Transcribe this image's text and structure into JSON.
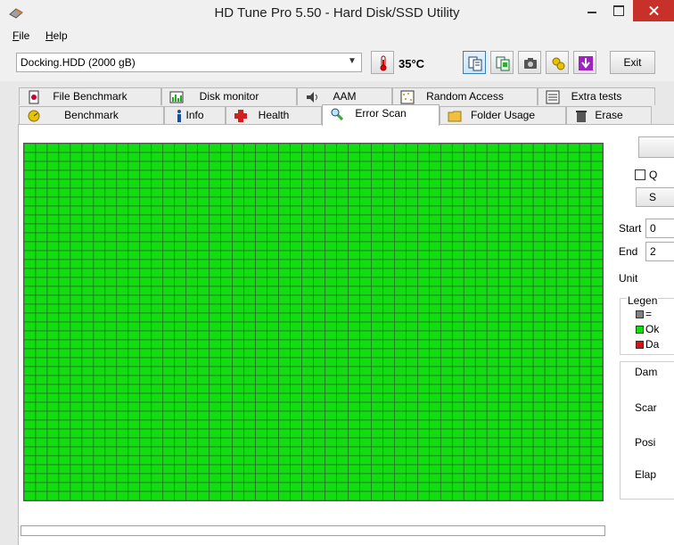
{
  "window": {
    "title": "HD Tune Pro 5.50 - Hard Disk/SSD Utility"
  },
  "menu": {
    "file_key": "F",
    "file_rest": "ile",
    "help_key": "H",
    "help_rest": "elp"
  },
  "toolbar": {
    "drive": "Docking.HDD (2000 gB)",
    "temperature": "35°C",
    "exit_label": "Exit"
  },
  "tabs_top": [
    {
      "label": "File Benchmark",
      "icon": "file-benchmark-icon"
    },
    {
      "label": "Disk monitor",
      "icon": "disk-monitor-icon"
    },
    {
      "label": "AAM",
      "icon": "speaker-icon"
    },
    {
      "label": "Random Access",
      "icon": "random-access-icon"
    },
    {
      "label": "Extra tests",
      "icon": "extra-tests-icon"
    }
  ],
  "tabs_bottom": [
    {
      "label": "Benchmark",
      "icon": "benchmark-icon"
    },
    {
      "label": "Info",
      "icon": "info-icon"
    },
    {
      "label": "Health",
      "icon": "health-cross-icon"
    },
    {
      "label": "Error Scan",
      "icon": "magnifier-icon",
      "selected": true
    },
    {
      "label": "Folder Usage",
      "icon": "folder-icon"
    },
    {
      "label": "Erase",
      "icon": "trash-icon"
    }
  ],
  "scan": {
    "block_color": "#11dd11",
    "grid_line_color": "#2a5a2a",
    "columns": 50,
    "rows": 40
  },
  "right_panel": {
    "quick_scan_label": "Q",
    "settings_btn_label": "S",
    "start_label": "Start",
    "start_value": "0",
    "end_label": "End",
    "end_value": "2",
    "unit_label": "Unit",
    "legend_title": "Legen",
    "legend_items": [
      {
        "label": "=",
        "color": "#808080"
      },
      {
        "label": "Ok",
        "color": "#11dd11"
      },
      {
        "label": "Da",
        "color": "#dd1111"
      }
    ],
    "damaged_label": "Dam",
    "scanned_label": "Scar",
    "position_label": "Posi",
    "elapsed_label": "Elap"
  }
}
